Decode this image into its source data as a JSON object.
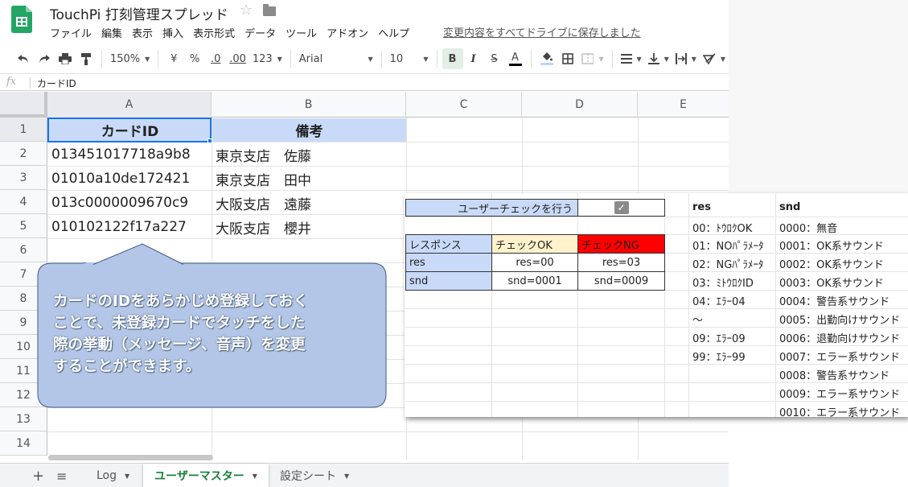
{
  "doc": {
    "title": "TouchPi 打刻管理スプレッド"
  },
  "menu": [
    "ファイル",
    "編集",
    "表示",
    "挿入",
    "表示形式",
    "データ",
    "ツール",
    "アドオン",
    "ヘルプ"
  ],
  "save_status": "変更内容をすべてドライブに保存しました",
  "toolbar": {
    "zoom": "150%",
    "currency": "¥",
    "percent": "%",
    "dec_less": ".0",
    "dec_more": ".00",
    "format_more": "123",
    "font": "Arial",
    "font_size": "10",
    "bold": "B",
    "italic": "I",
    "strike": "S",
    "text_color": "A"
  },
  "formula": {
    "fx": "fx",
    "content": "カードID"
  },
  "columns": [
    "A",
    "B",
    "C",
    "D",
    "E"
  ],
  "rows": [
    "1",
    "2",
    "3",
    "4",
    "5",
    "6",
    "7",
    "8",
    "9",
    "10",
    "11",
    "12",
    "13",
    "14"
  ],
  "sheet": {
    "header": [
      "カードID",
      "備考"
    ],
    "data": [
      [
        "013451017718a9b8",
        "東京支店　佐藤"
      ],
      [
        "01010a10de172421",
        "東京支店　田中"
      ],
      [
        "013c0000009670c9",
        "大阪支店　遠藤"
      ],
      [
        "010102122f17a227",
        "大阪支店　櫻井"
      ]
    ]
  },
  "callout": {
    "lines": [
      "カードのIDをあらかじめ登録しておく",
      "ことで、未登録カードでタッチをした",
      "際の挙動（メッセージ、音声）を変更",
      "することができます。"
    ]
  },
  "settings": {
    "user_check_label": "ユーザーチェックを行う",
    "table_header": [
      "レスポンス",
      "チェックOK",
      "チェックNG"
    ],
    "rows": [
      [
        "res",
        "res=00",
        "res=03"
      ],
      [
        "snd",
        "snd=0001",
        "snd=0009"
      ]
    ],
    "colors": {
      "label_bg": "#c9daf8",
      "ok_bg": "#fff2cc",
      "ng_bg": "#ff0000"
    },
    "res_header": "res",
    "snd_header": "snd",
    "res_list": [
      "00：ﾄｳﾛｸOK",
      "01：NOﾊﾟﾗﾒｰﾀ",
      "02：NGﾊﾟﾗﾒｰﾀ",
      "03：ﾐﾄｳﾛｸID",
      "04：ｴﾗｰ04",
      "〜",
      "09：ｴﾗｰ09",
      "99：ｴﾗｰ99"
    ],
    "snd_list": [
      "0000：無音",
      "0001：OK系サウンド",
      "0002：OK系サウンド",
      "0003：OK系サウンド",
      "0004：警告系サウンド",
      "0005：出勤向けサウンド",
      "0006：退勤向けサウンド",
      "0007：エラー系サウンド",
      "0008：警告系サウンド",
      "0009：エラー系サウンド",
      "0010：エラー系サウンド"
    ]
  },
  "tabs": [
    {
      "label": "Log",
      "active": false
    },
    {
      "label": "ユーザーマスター",
      "active": true
    },
    {
      "label": "設定シート",
      "active": false
    }
  ],
  "add_sheet": "+",
  "all_sheets": "≡"
}
